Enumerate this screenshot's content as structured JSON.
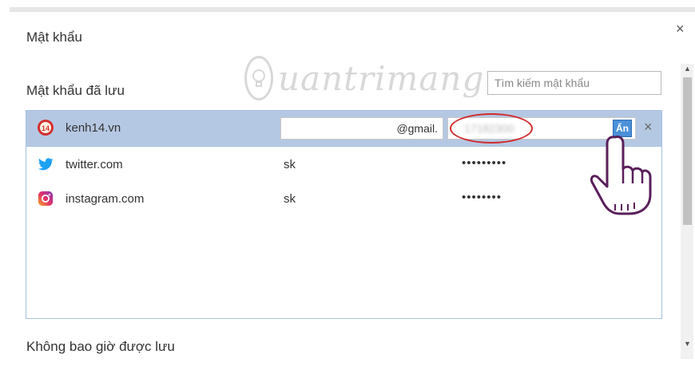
{
  "dialog": {
    "title": "Mật khẩu",
    "saved_section": "Mật khẩu đã lưu",
    "never_saved_section": "Không bao giờ được lưu",
    "search_placeholder": "Tìm kiếm mật khẩu",
    "close_symbol": "×"
  },
  "watermark": {
    "text": "uantrimang"
  },
  "passwords": [
    {
      "site": "kenh14.vn",
      "username": "@gmail.",
      "password": "17182300",
      "show_button": "Ẩn",
      "delete_symbol": "×",
      "icon": "kenh14-icon",
      "selected": true
    },
    {
      "site": "twitter.com",
      "username": "sk",
      "password": "•••••••••",
      "icon": "twitter-icon"
    },
    {
      "site": "instagram.com",
      "username": "sk",
      "password": "••••••••",
      "icon": "instagram-icon"
    }
  ],
  "colors": {
    "selected_row": "#b5c8e3",
    "list_border": "#a6c2e0",
    "highlight_oval": "#d22a2a",
    "show_button": "#4a90d9"
  }
}
